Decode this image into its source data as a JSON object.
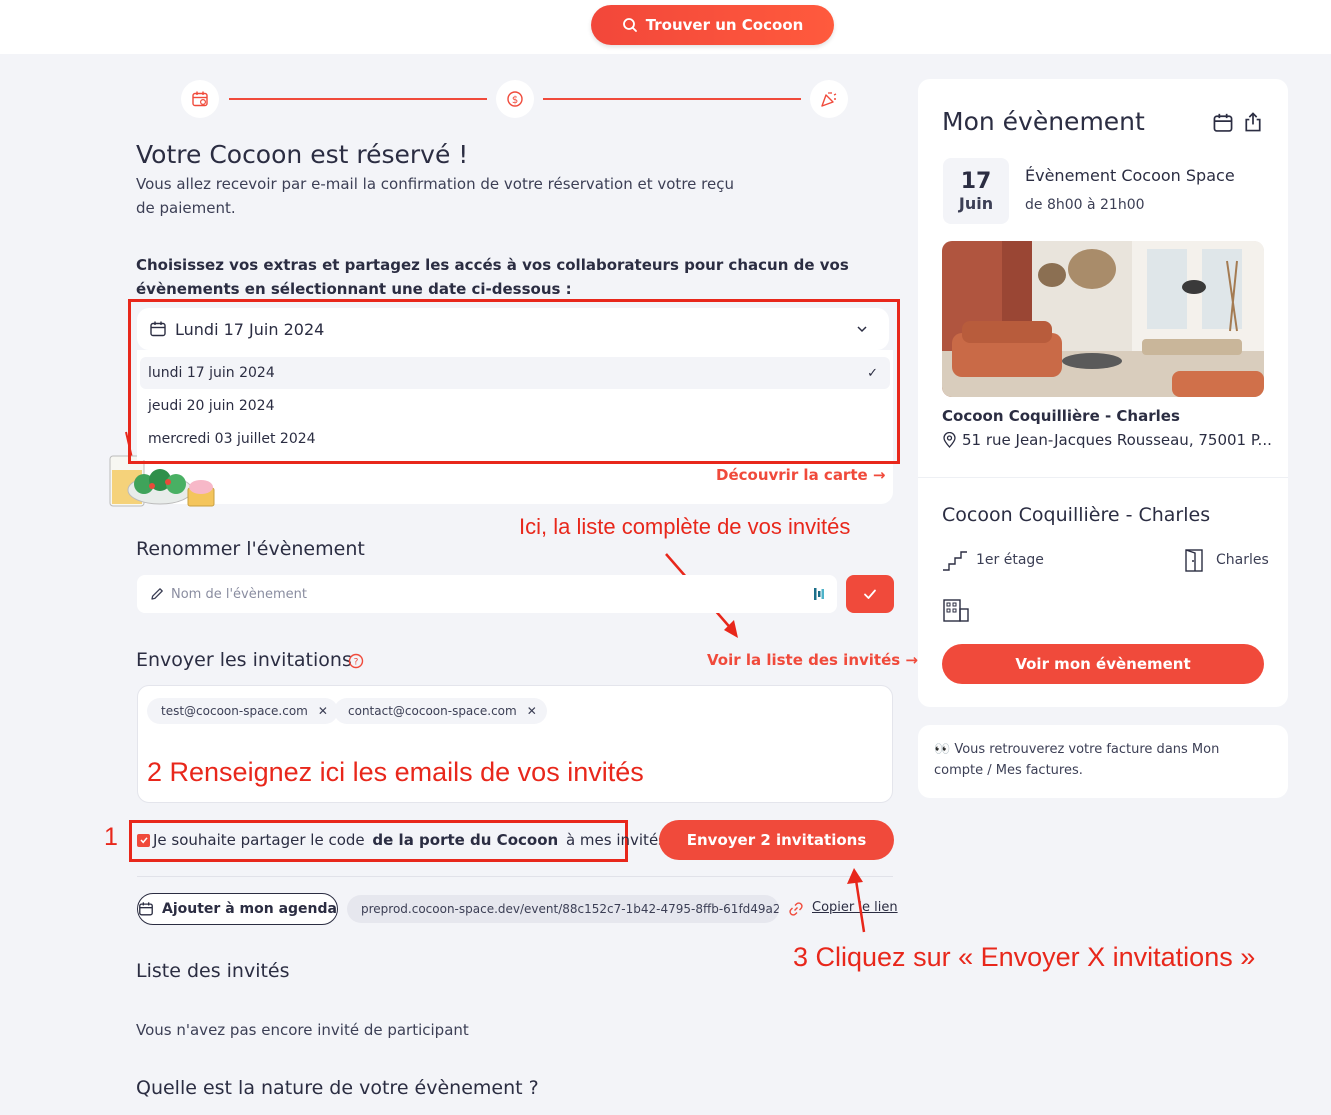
{
  "header": {
    "find_button": "Trouver un Cocoon"
  },
  "stepper": {
    "icons": [
      "calendar-icon",
      "dollar-icon",
      "party-icon"
    ]
  },
  "confirmation": {
    "title": "Votre Cocoon est réservé !",
    "subtitle": "Vous allez recevoir par e-mail la confirmation de votre réservation et votre reçu de paiement.",
    "instructions": "Choisissez vos extras et partagez les accés à vos collaborateurs pour chacun de vos évènements en sélectionnant une date ci-dessous :"
  },
  "date_select": {
    "selected": "Lundi 17 Juin 2024",
    "options": [
      "lundi 17 juin 2024",
      "jeudi 20 juin 2024",
      "mercredi 03 juillet 2024"
    ],
    "checkmark": "✓"
  },
  "extras": {
    "menu_link": "Découvrir la carte →"
  },
  "rename": {
    "title": "Renommer l'évènement",
    "placeholder": "Nom de l'évènement"
  },
  "invitations": {
    "title": "Envoyer les invitations",
    "guest_list_link": "Voir la liste des invités →",
    "emails": [
      "test@cocoon-space.com",
      "contact@cocoon-space.com"
    ],
    "share_code_prefix": "Je souhaite partager le code ",
    "share_code_bold": "de la porte du Cocoon",
    "share_code_suffix": " à mes invités",
    "share_code_checked": true,
    "send_button": "Envoyer 2 invitations",
    "add_agenda": "Ajouter à mon agenda",
    "event_url": "preprod.cocoon-space.dev/event/88c152c7-1b42-4795-8ffb-61fd49a26...",
    "copy_link": "Copier le lien"
  },
  "guest_list": {
    "title": "Liste des invités",
    "empty": "Vous n'avez pas encore invité de participant"
  },
  "event_nature": {
    "title": "Quelle est la nature de votre évènement ?"
  },
  "annotations": {
    "guest_list_hint": "Ici, la liste complète de vos invités",
    "step1": "1",
    "step2": "2 Renseignez ici les emails de vos invités",
    "step3": "3 Cliquez sur « Envoyer X invitations »"
  },
  "sidebar": {
    "title": "Mon évènement",
    "day": "17",
    "month": "Juin",
    "event_name": "Évènement Cocoon Space",
    "hours": "de 8h00 à 21h00",
    "venue": "Cocoon Coquillière - Charles",
    "address": "51 rue Jean-Jacques Rousseau, 75001 P...",
    "space_title": "Cocoon Coquillière - Charles",
    "floor": "1er étage",
    "room": "Charles",
    "view_button": "Voir mon évènement",
    "invoice_note": "👀 Vous retrouverez votre facture dans Mon compte / Mes factures."
  },
  "colors": {
    "accent": "#f04a3b",
    "annotation": "#e8271b",
    "background": "#f3f4f8"
  }
}
